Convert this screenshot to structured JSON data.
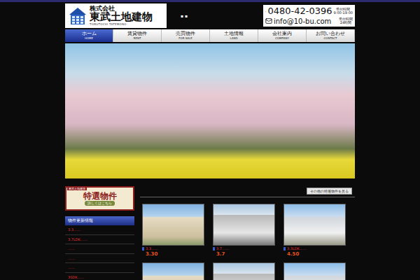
{
  "header": {
    "logo": {
      "sub": "株式会社",
      "name": "東武土地建物",
      "roman": "TOBUTOCHI TATEMONO"
    },
    "marks": "▪ ▪",
    "contact": {
      "phone": "0480-42-0396",
      "phone_hours_label": "受付時間",
      "phone_hours": "9:00-19:00",
      "email": "info@10-bu.com",
      "email_hours_label": "受付時間",
      "email_hours": "24時間"
    }
  },
  "nav": [
    {
      "label": "ホーム",
      "sub": "HOME",
      "selected": true
    },
    {
      "label": "賃貸物件",
      "sub": "RENT",
      "selected": false
    },
    {
      "label": "売買物件",
      "sub": "FOR SALE",
      "selected": false
    },
    {
      "label": "土地情報",
      "sub": "LAND",
      "selected": false
    },
    {
      "label": "会社案内",
      "sub": "COMPANY",
      "selected": false
    },
    {
      "label": "お問い合わせ",
      "sub": "CONTACT",
      "selected": false
    }
  ],
  "banner": {
    "tag": "東武土地建物",
    "title": "特選物件",
    "link": "詳しくはこちら"
  },
  "updates": {
    "title": "物件更新情報",
    "items": [
      "3.3……",
      "3.7LDK……",
      "……",
      "……",
      "……",
      "3SDK……"
    ]
  },
  "featured": {
    "more_button": "その他の特選物件を見る",
    "properties": [
      {
        "caption": "3.3……",
        "price": "3.30"
      },
      {
        "caption": "3.7……",
        "price": "3.7"
      },
      {
        "caption": "3.3LDK……",
        "price": "4.50"
      },
      {},
      {},
      {}
    ]
  }
}
